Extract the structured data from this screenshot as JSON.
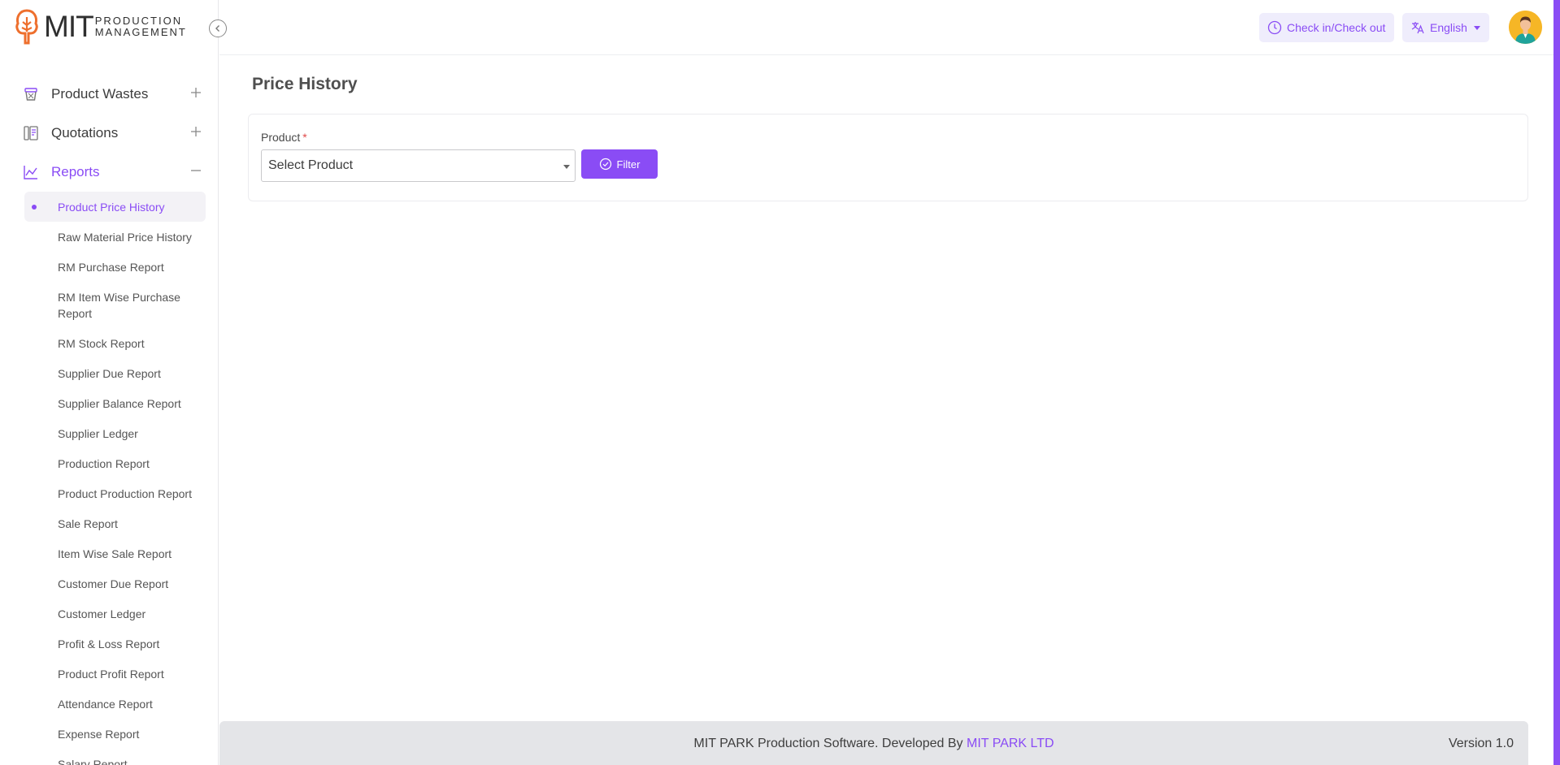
{
  "brand": {
    "logo_main": "MIT",
    "logo_line1": "PRODUCTION",
    "logo_line2": "MANAGEMENT",
    "accent_color": "#8a4cf5"
  },
  "sidebar": {
    "groups": [
      {
        "label": "Product Wastes",
        "icon": "basket-icon",
        "toggle": "plus"
      },
      {
        "label": "Quotations",
        "icon": "document-icon",
        "toggle": "plus"
      },
      {
        "label": "Reports",
        "icon": "chart-icon",
        "toggle": "minus",
        "active": true
      }
    ],
    "report_items": [
      {
        "label": "Product Price History",
        "active": true
      },
      {
        "label": "Raw Material Price History"
      },
      {
        "label": "RM Purchase Report"
      },
      {
        "label": "RM Item Wise Purchase Report"
      },
      {
        "label": "RM Stock Report"
      },
      {
        "label": "Supplier Due Report"
      },
      {
        "label": "Supplier Balance Report"
      },
      {
        "label": "Supplier Ledger"
      },
      {
        "label": "Production Report"
      },
      {
        "label": "Product Production Report"
      },
      {
        "label": "Sale Report"
      },
      {
        "label": "Item Wise Sale Report"
      },
      {
        "label": "Customer Due Report"
      },
      {
        "label": "Customer Ledger"
      },
      {
        "label": "Profit & Loss Report"
      },
      {
        "label": "Product Profit Report"
      },
      {
        "label": "Attendance Report"
      },
      {
        "label": "Expense Report"
      },
      {
        "label": "Salary Report"
      }
    ]
  },
  "header": {
    "checkin_label": "Check in/Check out",
    "language_label": "English"
  },
  "main": {
    "page_title": "Price History",
    "product_label": "Product",
    "required_mark": "*",
    "product_placeholder": "Select Product",
    "filter_label": "Filter"
  },
  "footer": {
    "text": "MIT PARK Production Software. Developed By",
    "link_text": "MIT PARK LTD",
    "version": "Version 1.0"
  }
}
